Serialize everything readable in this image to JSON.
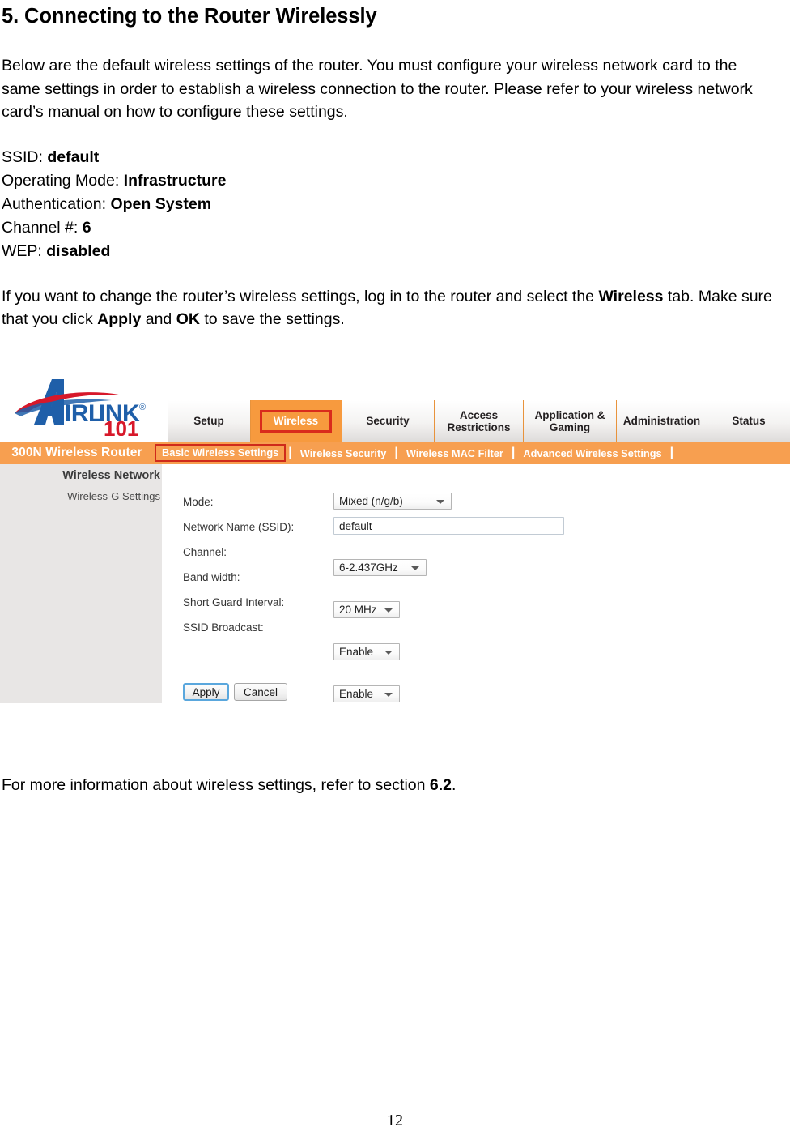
{
  "document": {
    "section_title": "5. Connecting to the Router Wirelessly",
    "intro_paragraph": "Below are the default wireless settings of the router. You must configure your wireless network card to the same settings in order to establish a wireless connection to the router. Please refer to your wireless network card’s manual on how to configure these settings.",
    "settings": [
      {
        "label": "SSID: ",
        "value": "default"
      },
      {
        "label": "Operating Mode: ",
        "value": "Infrastructure"
      },
      {
        "label": "Authentication: ",
        "value": "Open System"
      },
      {
        "label": "Channel #: ",
        "value": "6"
      },
      {
        "label": "WEP: ",
        "value": "disabled"
      }
    ],
    "instruction": {
      "part1": "If you want to change the router’s wireless settings, log in to the router and select the ",
      "bold1": "Wireless",
      "part2": " tab.  Make sure that you click ",
      "bold2": "Apply",
      "part3": " and ",
      "bold3": "OK",
      "part4": " to save the settings."
    },
    "footer_note": {
      "part1": "For more information about wireless settings, refer to section ",
      "bold1": "6.2",
      "part2": "."
    },
    "page_number": "12"
  },
  "router_ui": {
    "logo": {
      "brand_text": "AIRLINK",
      "registered_mark": "®",
      "model_number": "101"
    },
    "model_name": "300N Wireless Router",
    "tabs": [
      {
        "label": "Setup",
        "active": false
      },
      {
        "label": "Wireless",
        "active": true
      },
      {
        "label": "Security",
        "active": false
      },
      {
        "label": "Access Restrictions",
        "active": false
      },
      {
        "label": "Application & Gaming",
        "active": false
      },
      {
        "label": "Administration",
        "active": false
      },
      {
        "label": "Status",
        "active": false
      }
    ],
    "subnav": [
      {
        "label": "Basic Wireless Settings",
        "active": true
      },
      {
        "label": "Wireless Security",
        "active": false
      },
      {
        "label": "Wireless MAC Filter",
        "active": false
      },
      {
        "label": "Advanced Wireless Settings",
        "active": false
      }
    ],
    "sidebar": {
      "title": "Wireless Network",
      "subtitle": "Wireless-G Settings"
    },
    "form": {
      "fields": [
        {
          "label": "Mode:",
          "value": "Mixed (n/g/b)",
          "type": "select"
        },
        {
          "label": "Network Name (SSID):",
          "value": "default",
          "type": "text"
        },
        {
          "label": "Channel:",
          "value": "6-2.437GHz",
          "type": "select"
        },
        {
          "label": "Band width:",
          "value": "20 MHz",
          "type": "select"
        },
        {
          "label": "Short Guard Interval:",
          "value": "Enable",
          "type": "select"
        },
        {
          "label": "SSID Broadcast:",
          "value": "Enable",
          "type": "select"
        }
      ],
      "apply_button": "Apply",
      "cancel_button": "Cancel"
    },
    "colors": {
      "orange_bar": "#f79f50",
      "active_tab": "#f79a3e",
      "active_border": "#d92b1c",
      "sidebar_bg": "#e8e6e5",
      "logo_blue": "#1f5fa9",
      "logo_red": "#d7182a"
    }
  }
}
